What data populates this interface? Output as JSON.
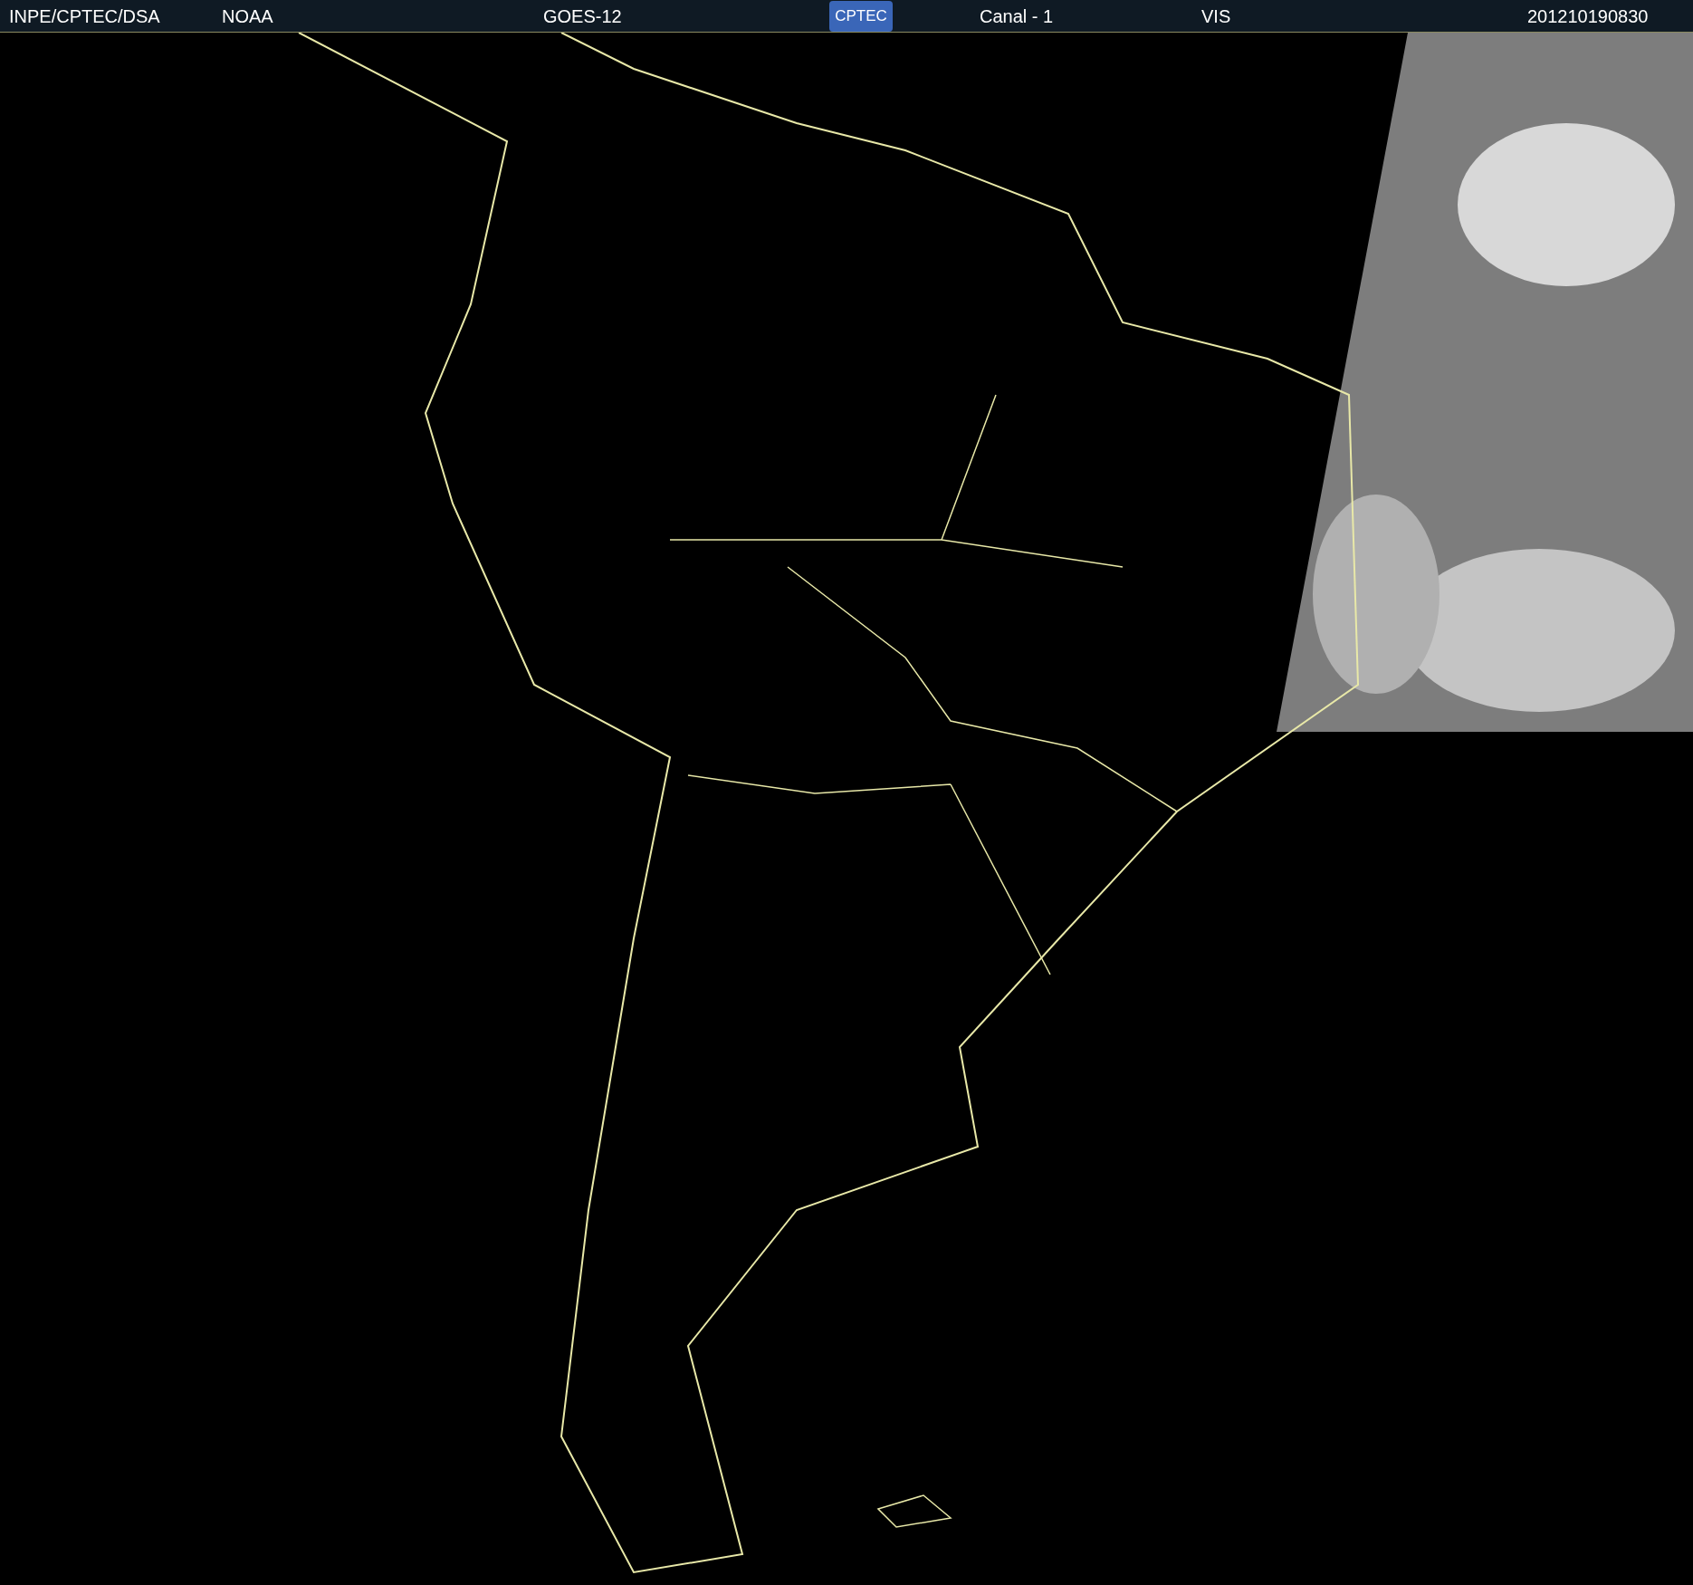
{
  "header": {
    "source": "INPE/CPTEC/DSA",
    "agency": "NOAA",
    "satellite": "GOES-12",
    "logo": "CPTEC",
    "channel": "Canal - 1",
    "band": "VIS",
    "timestamp": "201210190830"
  }
}
